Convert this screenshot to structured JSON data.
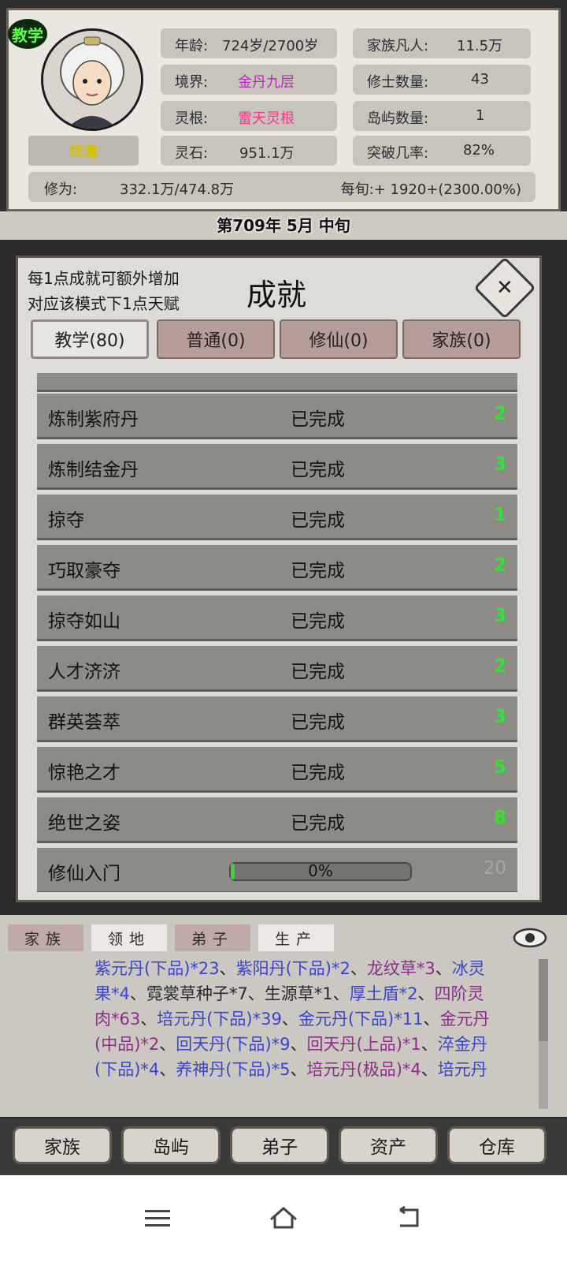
{
  "character": {
    "teach_badge": "教学",
    "name": "终澹",
    "stats": [
      {
        "label": "年龄:",
        "value": "724岁/2700岁",
        "color": "#2c2c2c"
      },
      {
        "label": "境界:",
        "value": "金丹九层",
        "color": "#b02fb0"
      },
      {
        "label": "灵根:",
        "value": "雷天灵根",
        "color": "#f03c8c"
      },
      {
        "label": "灵石:",
        "value": "951.1万",
        "color": "#2c2c2c"
      }
    ],
    "family_stats": [
      {
        "label": "家族凡人:",
        "value": "11.5万"
      },
      {
        "label": "修士数量:",
        "value": "43"
      },
      {
        "label": "岛屿数量:",
        "value": "1"
      },
      {
        "label": "突破几率:",
        "value": "82%"
      }
    ],
    "cultivation_label": "修为:",
    "cultivation_value": "332.1万/474.8万",
    "per_period": "每旬:+ 1920+(2300.00%)"
  },
  "date": "第709年 5月 中旬",
  "dialog": {
    "hint_line1": "每1点成就可额外增加",
    "hint_line2": "对应该模式下1点天赋",
    "title": "成就",
    "tabs": [
      "教学(80)",
      "普通(0)",
      "修仙(0)",
      "家族(0)"
    ],
    "rows": [
      {
        "name": "炼制紫府丹",
        "status": "已完成",
        "points": "2"
      },
      {
        "name": "炼制结金丹",
        "status": "已完成",
        "points": "3"
      },
      {
        "name": "掠夺",
        "status": "已完成",
        "points": "1"
      },
      {
        "name": "巧取豪夺",
        "status": "已完成",
        "points": "2"
      },
      {
        "name": "掠夺如山",
        "status": "已完成",
        "points": "3"
      },
      {
        "name": "人才济济",
        "status": "已完成",
        "points": "2"
      },
      {
        "name": "群英荟萃",
        "status": "已完成",
        "points": "3"
      },
      {
        "name": "惊艳之才",
        "status": "已完成",
        "points": "5"
      },
      {
        "name": "绝世之姿",
        "status": "已完成",
        "points": "8"
      }
    ],
    "progress_row": {
      "name": "修仙入门",
      "progress_text": "0%",
      "progress": 0.02,
      "points": "20"
    }
  },
  "info_tabs": [
    "家族",
    "领地",
    "弟子",
    "生产"
  ],
  "inventory_lines": [
    [
      {
        "t": "紫元丹(下品)*23",
        "c": "blue"
      },
      {
        "t": "、",
        "c": "plain"
      },
      {
        "t": "紫阳丹(下品)*2",
        "c": "blue"
      },
      {
        "t": "、",
        "c": "plain"
      },
      {
        "t": "龙纹草*3",
        "c": "purple"
      },
      {
        "t": "、",
        "c": "plain"
      },
      {
        "t": "冰灵",
        "c": "blue"
      }
    ],
    [
      {
        "t": "果*4",
        "c": "blue"
      },
      {
        "t": "、霓裳草种子*7、生源草*1、",
        "c": "plain"
      },
      {
        "t": "厚土盾*2",
        "c": "blue"
      },
      {
        "t": "、",
        "c": "plain"
      },
      {
        "t": "四阶灵",
        "c": "purple"
      }
    ],
    [
      {
        "t": "肉*63",
        "c": "purple"
      },
      {
        "t": "、",
        "c": "plain"
      },
      {
        "t": "培元丹(下品)*39",
        "c": "blue"
      },
      {
        "t": "、",
        "c": "plain"
      },
      {
        "t": "金元丹(下品)*11",
        "c": "blue"
      },
      {
        "t": "、",
        "c": "plain"
      },
      {
        "t": "金元丹",
        "c": "purple"
      }
    ],
    [
      {
        "t": "(中品)*2",
        "c": "purple"
      },
      {
        "t": "、",
        "c": "plain"
      },
      {
        "t": "回天丹(下品)*9",
        "c": "blue"
      },
      {
        "t": "、",
        "c": "plain"
      },
      {
        "t": "回天丹(上品)*1",
        "c": "purple"
      },
      {
        "t": "、",
        "c": "plain"
      },
      {
        "t": "淬金丹",
        "c": "blue"
      }
    ],
    [
      {
        "t": "(下品)*4",
        "c": "blue"
      },
      {
        "t": "、",
        "c": "plain"
      },
      {
        "t": "养神丹(下品)*5",
        "c": "blue"
      },
      {
        "t": "、",
        "c": "plain"
      },
      {
        "t": "培元丹(极品)*4",
        "c": "purple"
      },
      {
        "t": "、",
        "c": "plain"
      },
      {
        "t": "培元丹",
        "c": "blue"
      }
    ]
  ],
  "bottom_nav": [
    "家族",
    "岛屿",
    "弟子",
    "资产",
    "仓库"
  ],
  "icons": {
    "close": "close-icon",
    "eye": "eye-icon",
    "menu": "menu-icon",
    "home": "home-icon",
    "back": "back-icon"
  }
}
